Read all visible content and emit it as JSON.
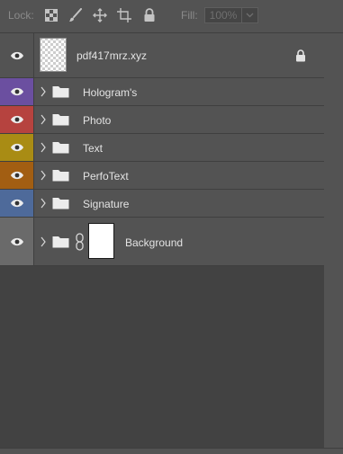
{
  "lock_bar": {
    "lock_label": "Lock:",
    "fill_label": "Fill:",
    "fill_value": "100%",
    "icons": [
      "lock-transparent-pixels-icon",
      "lock-image-pixels-icon",
      "lock-position-icon",
      "lock-artboard-icon",
      "lock-all-icon"
    ]
  },
  "layers": {
    "top_layer": {
      "name": "pdf417mrz.xyz",
      "locked": true,
      "eye_color": "#535353"
    },
    "groups": [
      {
        "name": "Hologram's",
        "color": "#6b4fa0"
      },
      {
        "name": "Photo",
        "color": "#b6433f"
      },
      {
        "name": "Text",
        "color": "#a98c14"
      },
      {
        "name": "PerfoText",
        "color": "#a25e12"
      },
      {
        "name": "Signature",
        "color": "#4e6a9a"
      }
    ],
    "background": {
      "name": "Background",
      "eye_color": "#6a6a6a"
    }
  },
  "icons": {
    "eye": "eye-icon",
    "chevron": "chevron-right-icon",
    "folder": "folder-icon",
    "link": "link-icon",
    "lock": "lock-icon"
  }
}
